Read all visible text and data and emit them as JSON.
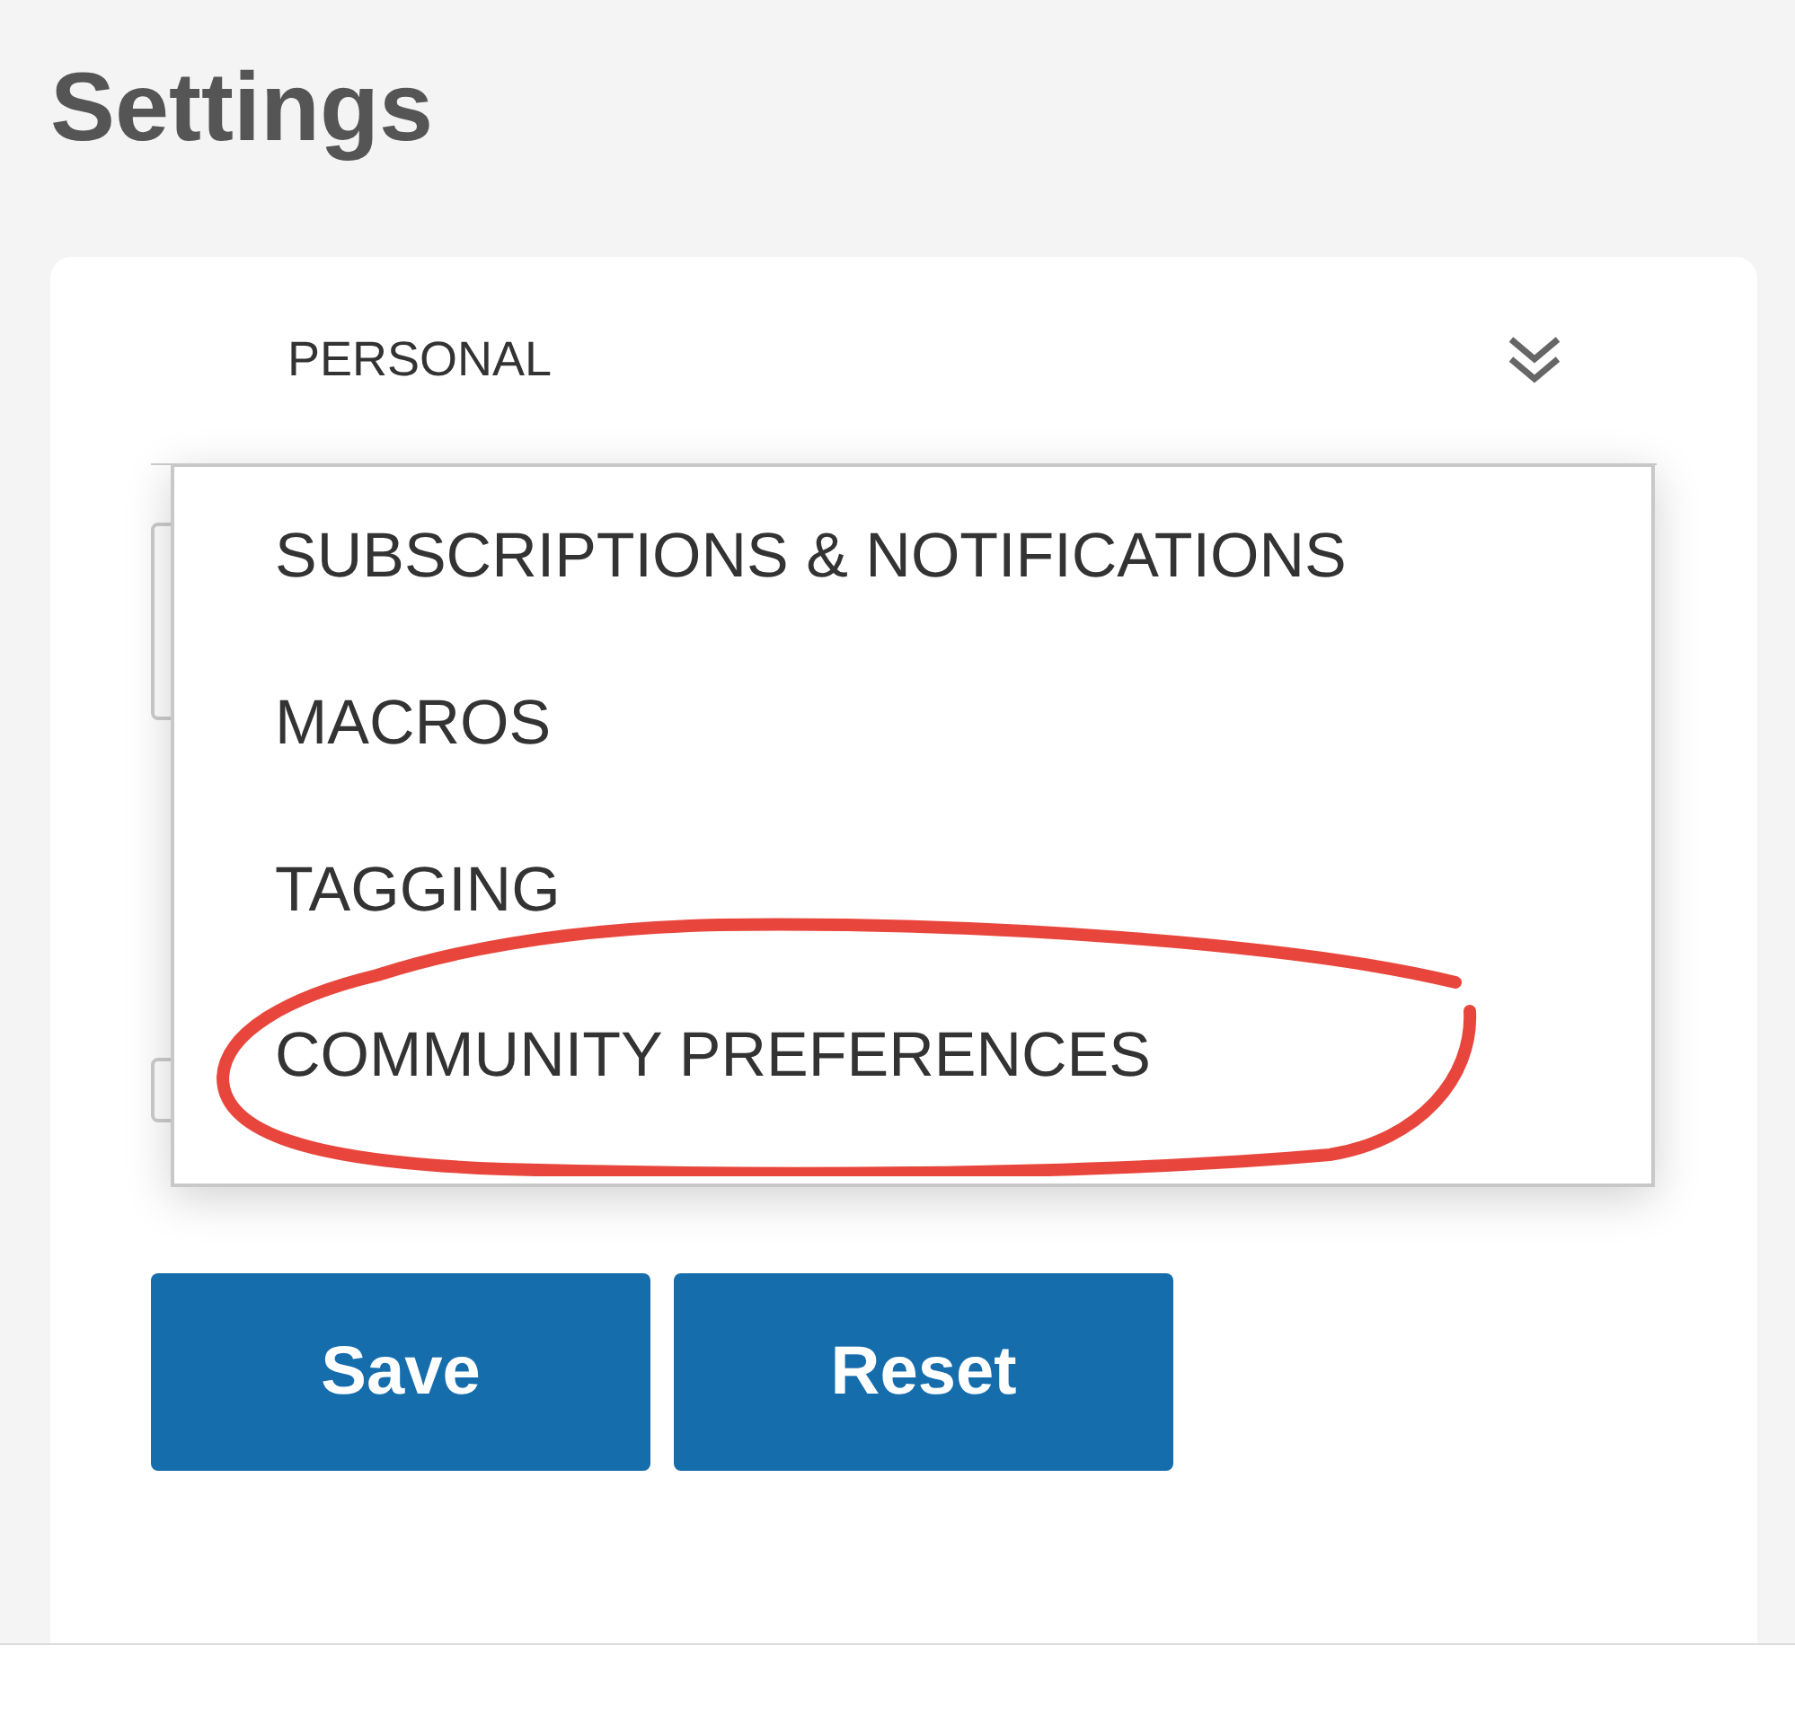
{
  "page_title": "Settings",
  "section": {
    "label": "PERSONAL",
    "expanded": true
  },
  "menu": {
    "items": [
      {
        "label": "SUBSCRIPTIONS & NOTIFICATIONS",
        "circled": false
      },
      {
        "label": "MACROS",
        "circled": false
      },
      {
        "label": "TAGGING",
        "circled": false
      },
      {
        "label": "COMMUNITY PREFERENCES",
        "circled": true
      }
    ]
  },
  "buttons": [
    {
      "label": "Save"
    },
    {
      "label": "Reset"
    }
  ]
}
